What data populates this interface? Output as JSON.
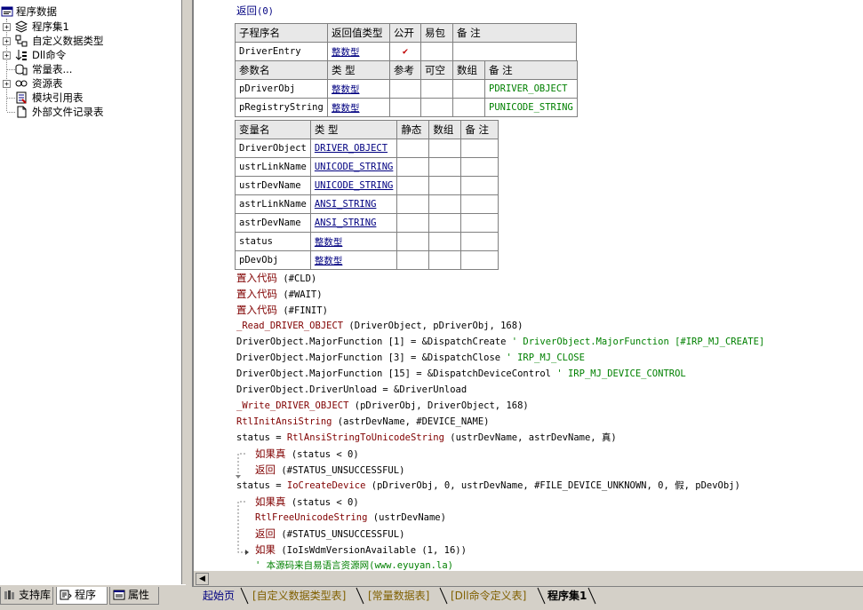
{
  "tree": {
    "root": "程序数据",
    "items": [
      {
        "label": "程序集1",
        "icon": "layers-icon"
      },
      {
        "label": "自定义数据类型",
        "icon": "type-icon"
      },
      {
        "label": "Dll命令",
        "icon": "dll-icon"
      },
      {
        "label": "常量表...",
        "icon": "constants-icon"
      },
      {
        "label": "资源表",
        "icon": "resource-icon"
      },
      {
        "label": "模块引用表",
        "icon": "module-icon"
      },
      {
        "label": "外部文件记录表",
        "icon": "file-icon"
      }
    ]
  },
  "left_tabs": [
    "支持库",
    "程序",
    "属性"
  ],
  "editor": {
    "return_line": {
      "kw": "返回",
      "arg": "(0)"
    },
    "sub_table": {
      "headers": [
        "子程序名",
        "返回值类型",
        "公开",
        "易包",
        "备 注"
      ],
      "row": {
        "name": "DriverEntry",
        "type": "整数型",
        "public": "✔"
      }
    },
    "param_table": {
      "headers": [
        "参数名",
        "类 型",
        "参考",
        "可空",
        "数组",
        "备 注"
      ],
      "rows": [
        {
          "name": "pDriverObj",
          "type": "整数型",
          "note": "PDRIVER_OBJECT"
        },
        {
          "name": "pRegistryString",
          "type": "整数型",
          "note": "PUNICODE_STRING"
        }
      ]
    },
    "var_table": {
      "headers": [
        "变量名",
        "类 型",
        "静态",
        "数组",
        "备 注"
      ],
      "rows": [
        {
          "name": "DriverObject",
          "type": "DRIVER_OBJECT"
        },
        {
          "name": "ustrLinkName",
          "type": "UNICODE_STRING"
        },
        {
          "name": "ustrDevName",
          "type": "UNICODE_STRING"
        },
        {
          "name": "astrLinkName",
          "type": "ANSI_STRING"
        },
        {
          "name": "astrDevName",
          "type": "ANSI_STRING"
        },
        {
          "name": "status",
          "type": "整数型"
        },
        {
          "name": "pDevObj",
          "type": "整数型"
        }
      ]
    },
    "code": [
      {
        "a": "置入代码",
        "b": " (#CLD)",
        "ca": "kw",
        "indent": 0
      },
      {
        "a": "置入代码",
        "b": " (#WAIT)",
        "ca": "kw",
        "indent": 0
      },
      {
        "a": "置入代码",
        "b": " (#FINIT)",
        "ca": "kw",
        "indent": 0
      },
      {
        "a": "_Read_DRIVER_OBJECT",
        "b": " (DriverObject, pDriverObj, 168)",
        "ca": "fn",
        "indent": 0
      },
      {
        "a": "DriverObject.MajorFunction [1] = &DispatchCreate",
        "b": "  ' DriverObject.MajorFunction [#IRP_MJ_CREATE]",
        "ca": "plain",
        "cb": "cm",
        "indent": 0
      },
      {
        "a": "DriverObject.MajorFunction [3] = &DispatchClose",
        "b": "  ' IRP_MJ_CLOSE",
        "ca": "plain",
        "cb": "cm",
        "indent": 0
      },
      {
        "a": "DriverObject.MajorFunction [15] = &DispatchDeviceControl",
        "b": "  ' IRP_MJ_DEVICE_CONTROL",
        "ca": "plain",
        "cb": "cm",
        "indent": 0
      },
      {
        "a": "DriverObject.DriverUnload = &DriverUnload",
        "b": "",
        "ca": "plain",
        "indent": 0
      },
      {
        "a": "_Write_DRIVER_OBJECT",
        "b": " (pDriverObj, DriverObject, 168)",
        "ca": "fn",
        "indent": 0
      },
      {
        "a": "RtlInitAnsiString",
        "b": " (astrDevName, #DEVICE_NAME)",
        "ca": "fn",
        "indent": 0
      },
      {
        "a": "status = ",
        "b": "RtlAnsiStringToUnicodeString",
        "c": " (ustrDevName, astrDevName, 真)",
        "ca": "plain",
        "cb": "fn",
        "indent": 0
      },
      {
        "a": "如果真",
        "b": " (status < 0)",
        "ca": "kw",
        "indent": 1
      },
      {
        "a": "返回",
        "b": " (#STATUS_UNSUCCESSFUL)",
        "ca": "kw",
        "indent": 1
      },
      {
        "a": "status = ",
        "b": "IoCreateDevice",
        "c": " (pDriverObj, 0, ustrDevName, #FILE_DEVICE_UNKNOWN, 0, 假, pDevObj)",
        "ca": "plain",
        "cb": "fn",
        "indent": 0
      },
      {
        "a": "如果真",
        "b": " (status < 0)",
        "ca": "kw",
        "indent": 1
      },
      {
        "a": "RtlFreeUnicodeString",
        "b": " (ustrDevName)",
        "ca": "fn",
        "indent": 1
      },
      {
        "a": "返回",
        "b": " (#STATUS_UNSUCCESSFUL)",
        "ca": "kw",
        "indent": 1
      },
      {
        "a": "如果",
        "b": " (IoIsWdmVersionAvailable (1, 16))",
        "ca": "kw",
        "indent": 1
      },
      {
        "a": "' 本源码来自易语言资源网(www.eyuyan.la)",
        "b": "",
        "ca": "cm",
        "indent": 1
      }
    ]
  },
  "bottom_tabs": [
    "起始页",
    "[自定义数据类型表]",
    "[常量数据表]",
    "[Dll命令定义表]",
    "程序集1"
  ]
}
